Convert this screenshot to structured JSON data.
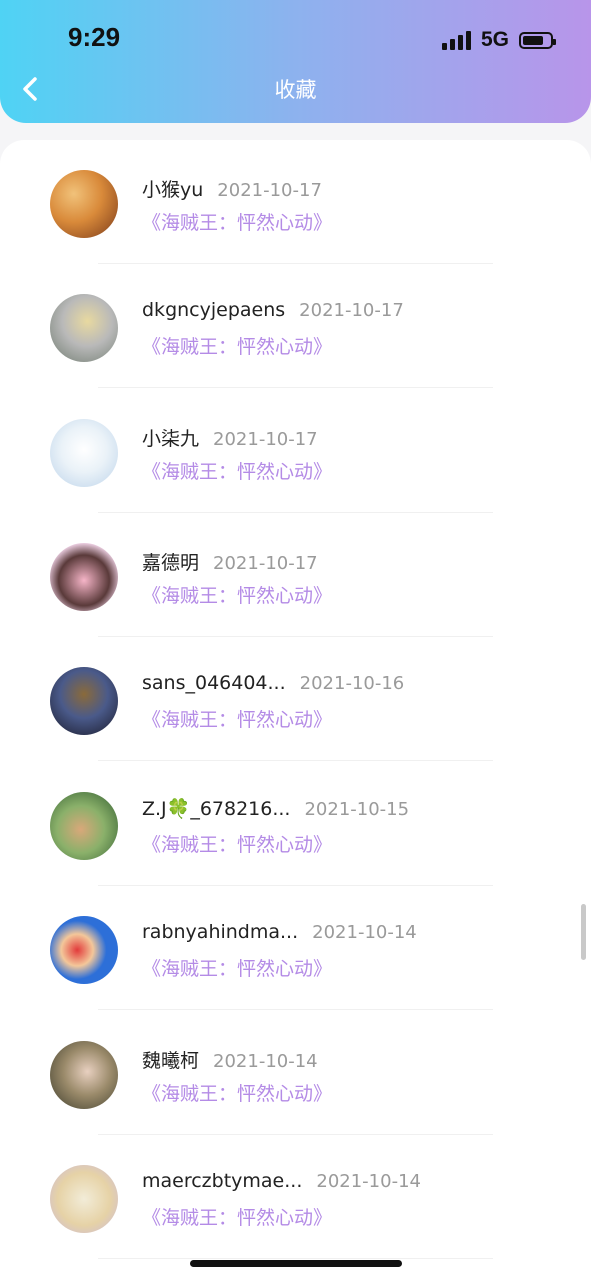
{
  "status_bar": {
    "time": "9:29",
    "network": "5G"
  },
  "header": {
    "title": "收藏"
  },
  "items": [
    {
      "name": "小猴yu",
      "date": "2021-10-17",
      "work": "《海贼王：怦然心动》",
      "avatar_colors": [
        "#7a3a1a",
        "#d98a3a",
        "#f1c27a"
      ]
    },
    {
      "name": "dkgncyjepaens",
      "date": "2021-10-17",
      "work": "《海贼王：怦然心动》",
      "avatar_colors": [
        "#6e7a6e",
        "#e8d9a0",
        "#b9b9b9"
      ]
    },
    {
      "name": "小柒九",
      "date": "2021-10-17",
      "work": "《海贼王：怦然心动》",
      "avatar_colors": [
        "#eaf2f8",
        "#bcd3ea",
        "#ffffff"
      ]
    },
    {
      "name": "嘉德明",
      "date": "2021-10-17",
      "work": "《海贼王：怦然心动》",
      "avatar_colors": [
        "#f3d6ea",
        "#5a3a3a",
        "#f6b5c8"
      ]
    },
    {
      "name": "sans_046404...",
      "date": "2021-10-16",
      "work": "《海贼王：怦然心动》",
      "avatar_colors": [
        "#1a1a2a",
        "#8a6a3a",
        "#4a5a8a"
      ]
    },
    {
      "name": "Z.J🍀_678216...",
      "date": "2021-10-15",
      "work": "《海贼王：怦然心动》",
      "avatar_colors": [
        "#2e5a2e",
        "#d9a87a",
        "#8ab06a"
      ]
    },
    {
      "name": "rabnyahindma...",
      "date": "2021-10-14",
      "work": "《海贼王：怦然心动》",
      "avatar_colors": [
        "#2d6fd8",
        "#e23b3b",
        "#f3c79a"
      ]
    },
    {
      "name": "魏曦柯",
      "date": "2021-10-14",
      "work": "《海贼王：怦然心动》",
      "avatar_colors": [
        "#3a3a2a",
        "#e8d0c0",
        "#9a8a6a"
      ]
    },
    {
      "name": "maerczbtymae...",
      "date": "2021-10-14",
      "work": "《海贼王：怦然心动》",
      "avatar_colors": [
        "#f2ecd8",
        "#e6d2a6",
        "#c9b8e0"
      ]
    }
  ]
}
